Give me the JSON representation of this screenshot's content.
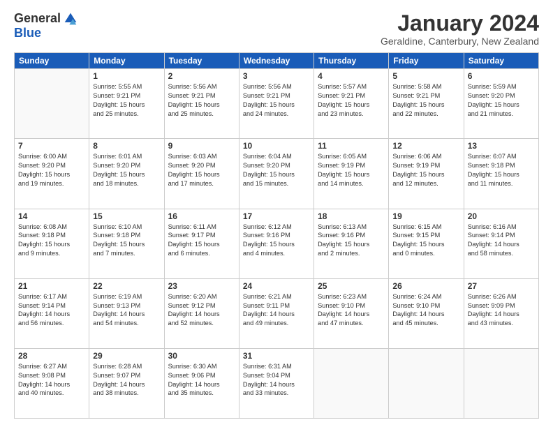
{
  "logo": {
    "general": "General",
    "blue": "Blue"
  },
  "title": "January 2024",
  "location": "Geraldine, Canterbury, New Zealand",
  "weekdays": [
    "Sunday",
    "Monday",
    "Tuesday",
    "Wednesday",
    "Thursday",
    "Friday",
    "Saturday"
  ],
  "weeks": [
    [
      {
        "day": "",
        "info": ""
      },
      {
        "day": "1",
        "info": "Sunrise: 5:55 AM\nSunset: 9:21 PM\nDaylight: 15 hours\nand 25 minutes."
      },
      {
        "day": "2",
        "info": "Sunrise: 5:56 AM\nSunset: 9:21 PM\nDaylight: 15 hours\nand 25 minutes."
      },
      {
        "day": "3",
        "info": "Sunrise: 5:56 AM\nSunset: 9:21 PM\nDaylight: 15 hours\nand 24 minutes."
      },
      {
        "day": "4",
        "info": "Sunrise: 5:57 AM\nSunset: 9:21 PM\nDaylight: 15 hours\nand 23 minutes."
      },
      {
        "day": "5",
        "info": "Sunrise: 5:58 AM\nSunset: 9:21 PM\nDaylight: 15 hours\nand 22 minutes."
      },
      {
        "day": "6",
        "info": "Sunrise: 5:59 AM\nSunset: 9:20 PM\nDaylight: 15 hours\nand 21 minutes."
      }
    ],
    [
      {
        "day": "7",
        "info": "Sunrise: 6:00 AM\nSunset: 9:20 PM\nDaylight: 15 hours\nand 19 minutes."
      },
      {
        "day": "8",
        "info": "Sunrise: 6:01 AM\nSunset: 9:20 PM\nDaylight: 15 hours\nand 18 minutes."
      },
      {
        "day": "9",
        "info": "Sunrise: 6:03 AM\nSunset: 9:20 PM\nDaylight: 15 hours\nand 17 minutes."
      },
      {
        "day": "10",
        "info": "Sunrise: 6:04 AM\nSunset: 9:20 PM\nDaylight: 15 hours\nand 15 minutes."
      },
      {
        "day": "11",
        "info": "Sunrise: 6:05 AM\nSunset: 9:19 PM\nDaylight: 15 hours\nand 14 minutes."
      },
      {
        "day": "12",
        "info": "Sunrise: 6:06 AM\nSunset: 9:19 PM\nDaylight: 15 hours\nand 12 minutes."
      },
      {
        "day": "13",
        "info": "Sunrise: 6:07 AM\nSunset: 9:18 PM\nDaylight: 15 hours\nand 11 minutes."
      }
    ],
    [
      {
        "day": "14",
        "info": "Sunrise: 6:08 AM\nSunset: 9:18 PM\nDaylight: 15 hours\nand 9 minutes."
      },
      {
        "day": "15",
        "info": "Sunrise: 6:10 AM\nSunset: 9:18 PM\nDaylight: 15 hours\nand 7 minutes."
      },
      {
        "day": "16",
        "info": "Sunrise: 6:11 AM\nSunset: 9:17 PM\nDaylight: 15 hours\nand 6 minutes."
      },
      {
        "day": "17",
        "info": "Sunrise: 6:12 AM\nSunset: 9:16 PM\nDaylight: 15 hours\nand 4 minutes."
      },
      {
        "day": "18",
        "info": "Sunrise: 6:13 AM\nSunset: 9:16 PM\nDaylight: 15 hours\nand 2 minutes."
      },
      {
        "day": "19",
        "info": "Sunrise: 6:15 AM\nSunset: 9:15 PM\nDaylight: 15 hours\nand 0 minutes."
      },
      {
        "day": "20",
        "info": "Sunrise: 6:16 AM\nSunset: 9:14 PM\nDaylight: 14 hours\nand 58 minutes."
      }
    ],
    [
      {
        "day": "21",
        "info": "Sunrise: 6:17 AM\nSunset: 9:14 PM\nDaylight: 14 hours\nand 56 minutes."
      },
      {
        "day": "22",
        "info": "Sunrise: 6:19 AM\nSunset: 9:13 PM\nDaylight: 14 hours\nand 54 minutes."
      },
      {
        "day": "23",
        "info": "Sunrise: 6:20 AM\nSunset: 9:12 PM\nDaylight: 14 hours\nand 52 minutes."
      },
      {
        "day": "24",
        "info": "Sunrise: 6:21 AM\nSunset: 9:11 PM\nDaylight: 14 hours\nand 49 minutes."
      },
      {
        "day": "25",
        "info": "Sunrise: 6:23 AM\nSunset: 9:10 PM\nDaylight: 14 hours\nand 47 minutes."
      },
      {
        "day": "26",
        "info": "Sunrise: 6:24 AM\nSunset: 9:10 PM\nDaylight: 14 hours\nand 45 minutes."
      },
      {
        "day": "27",
        "info": "Sunrise: 6:26 AM\nSunset: 9:09 PM\nDaylight: 14 hours\nand 43 minutes."
      }
    ],
    [
      {
        "day": "28",
        "info": "Sunrise: 6:27 AM\nSunset: 9:08 PM\nDaylight: 14 hours\nand 40 minutes."
      },
      {
        "day": "29",
        "info": "Sunrise: 6:28 AM\nSunset: 9:07 PM\nDaylight: 14 hours\nand 38 minutes."
      },
      {
        "day": "30",
        "info": "Sunrise: 6:30 AM\nSunset: 9:06 PM\nDaylight: 14 hours\nand 35 minutes."
      },
      {
        "day": "31",
        "info": "Sunrise: 6:31 AM\nSunset: 9:04 PM\nDaylight: 14 hours\nand 33 minutes."
      },
      {
        "day": "",
        "info": ""
      },
      {
        "day": "",
        "info": ""
      },
      {
        "day": "",
        "info": ""
      }
    ]
  ]
}
